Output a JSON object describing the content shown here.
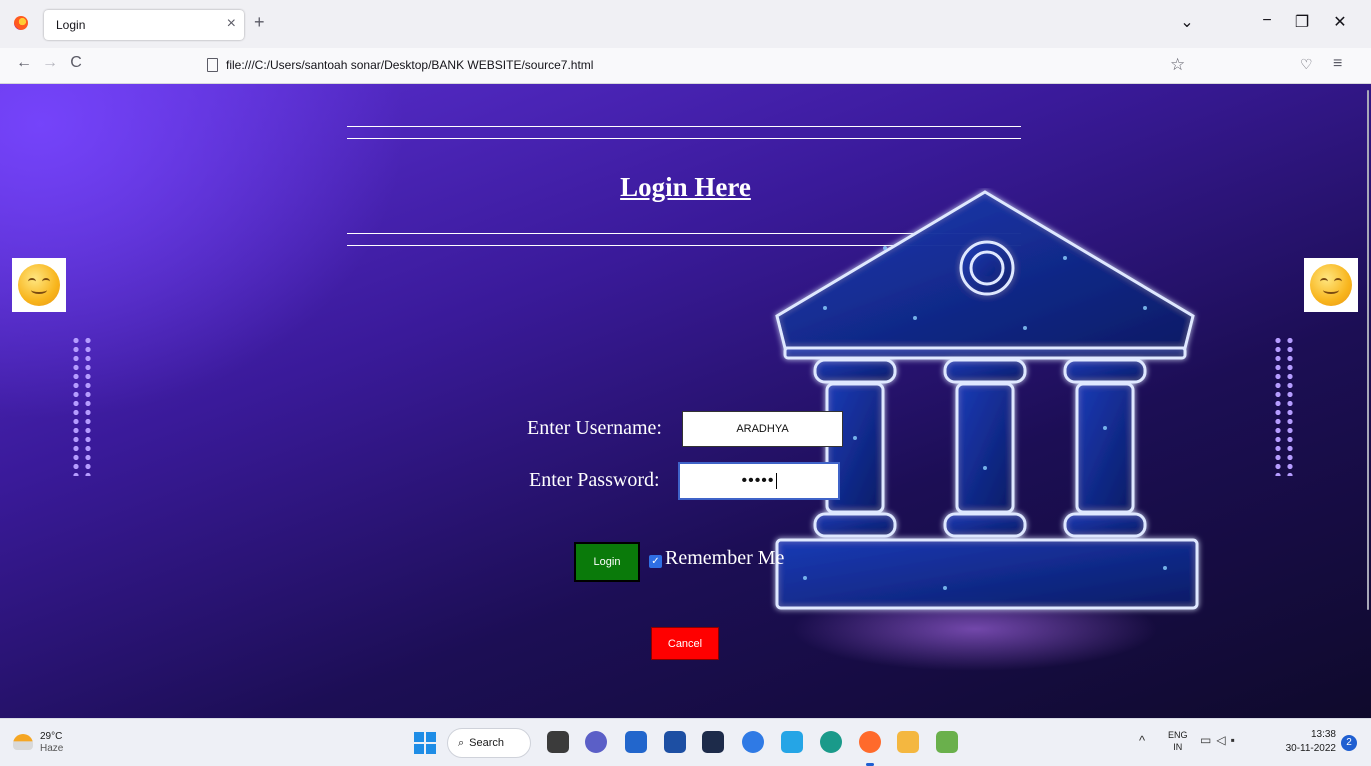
{
  "browser": {
    "tab_title": "Login",
    "tab_close": "×",
    "new_tab": "+",
    "url": "file:///C:/Users/santoah sonar/Desktop/BANK WEBSITE/source7.html",
    "window_buttons": {
      "list_tabs": "⌄",
      "minimize": "−",
      "restore": "❐",
      "close": "✕"
    },
    "nav": {
      "back": "←",
      "forward": "→",
      "reload": "C"
    }
  },
  "page": {
    "heading": "Login Here",
    "username_label": "Enter Username:",
    "username_value": "ARADHYA",
    "password_label": "Enter Password:",
    "password_value": "•••••",
    "login_button": "Login",
    "remember_checked": true,
    "remember_label": "Remember Me",
    "cancel_button": "Cancel",
    "colors": {
      "login_button": "#0a7a0a",
      "cancel_button": "#ff0000",
      "background": "#3a1a9a"
    }
  },
  "taskbar": {
    "weather_temp": "29°C",
    "weather_desc": "Haze",
    "search_label": "Search",
    "apps": [
      "windows-start-icon",
      "file-explorer-icon",
      "teams-chat-icon",
      "microsoft-store-icon",
      "mail-icon",
      "dropbox-icon",
      "spark-icon",
      "vscode-icon",
      "edge-icon",
      "firefox-icon",
      "folder-icon",
      "paint-icon"
    ],
    "lang_top": "ENG",
    "lang_bottom": "IN",
    "time": "13:38",
    "date": "30-11-2022",
    "notification_count": "2"
  }
}
